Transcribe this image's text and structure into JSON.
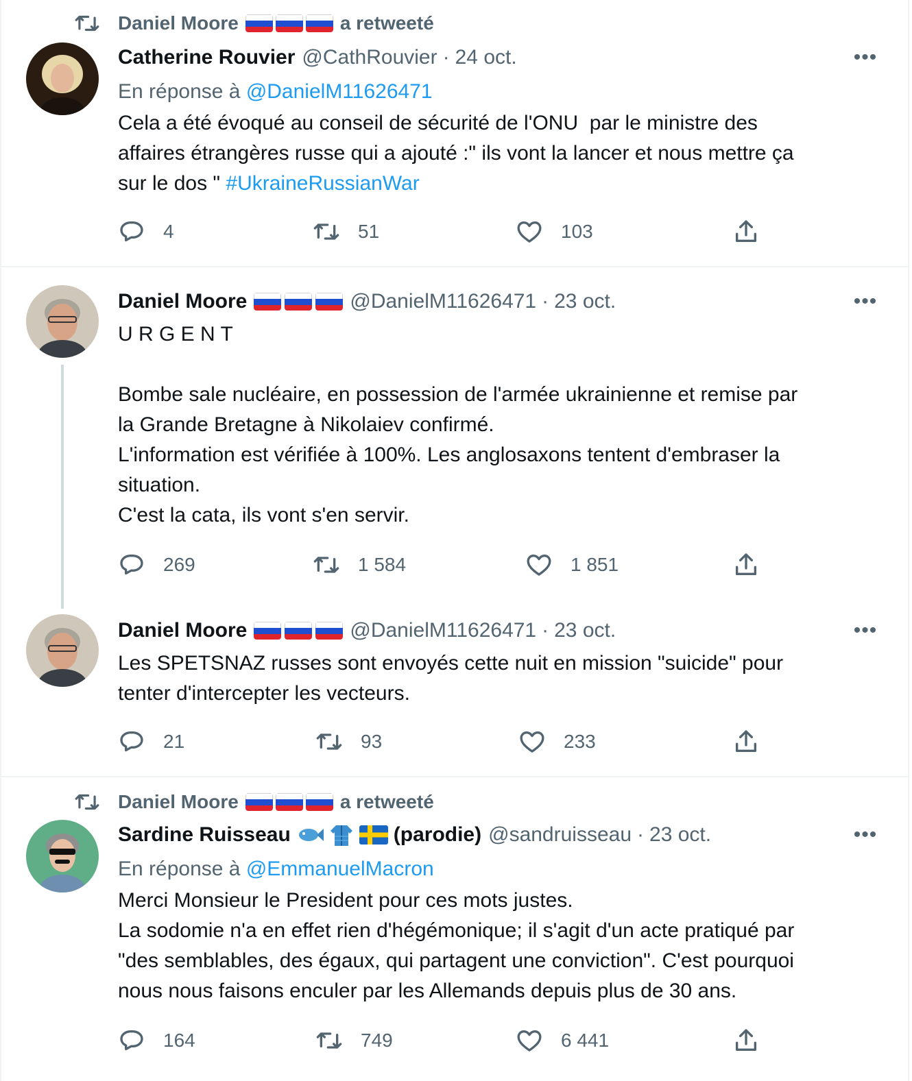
{
  "retweet_label": "a retweeté",
  "retweeter_name": "Daniel Moore",
  "reply_prefix": "En réponse à",
  "tweets": [
    {
      "author": "Catherine Rouvier",
      "handle": "@CathRouvier",
      "date": "24 oct.",
      "reply_to": "@DanielM11626471",
      "text": "Cela a été évoqué au conseil de sécurité de l'ONU  par le ministre des\naffaires étrangères russe qui a ajouté :\" ils vont la lancer et nous mettre ça\nsur le dos \" ",
      "hashtag": "#UkraineRussianWar",
      "replies": "4",
      "retweets": "51",
      "likes": "103"
    },
    {
      "author": "Daniel Moore",
      "handle": "@DanielM11626471",
      "date": "23 oct.",
      "text": "U R G E N T\n\nBombe sale nucléaire, en possession de l'armée ukrainienne et remise par\nla Grande Bretagne à Nikolaiev confirmé.\nL'information est vérifiée à 100%. Les anglosaxons tentent d'embraser la\nsituation.\nC'est la cata, ils vont s'en servir.",
      "replies": "269",
      "retweets": "1 584",
      "likes": "1 851"
    },
    {
      "author": "Daniel Moore",
      "handle": "@DanielM11626471",
      "date": "23 oct.",
      "text": "Les SPETSNAZ russes sont envoyés cette nuit en mission \"suicide\" pour\ntenter d'intercepter les vecteurs.",
      "replies": "21",
      "retweets": "93",
      "likes": "233"
    },
    {
      "author": "Sardine Ruisseau",
      "author_suffix": "(parodie)",
      "handle": "@sandruisseau",
      "date": "23 oct.",
      "reply_to": "@EmmanuelMacron",
      "text": "Merci Monsieur le President pour ces mots justes.\nLa sodomie n'a en effet rien d'hégémonique; il s'agit d'un acte pratiqué par\n\"des semblables, des égaux, qui partagent une conviction\". C'est pourquoi\nnous nous faisons enculer par les Allemands depuis plus de 30 ans.",
      "replies": "164",
      "retweets": "749",
      "likes": "6 441"
    }
  ],
  "icons": {
    "reply": "reply-icon",
    "retweet": "retweet-icon",
    "like": "heart-icon",
    "share": "share-icon",
    "more": "more-icon"
  },
  "colors": {
    "link": "#1d9bf0",
    "secondary": "#536471",
    "text": "#0f1419",
    "divider": "#eff3f4"
  }
}
